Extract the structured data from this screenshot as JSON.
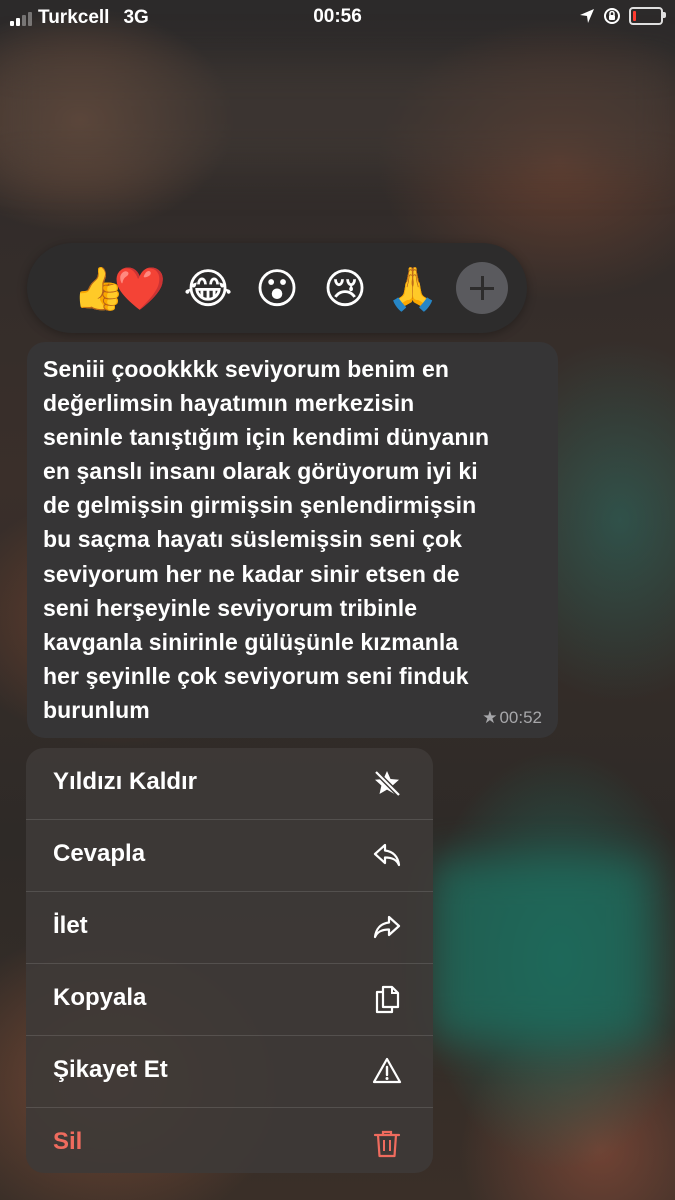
{
  "status_bar": {
    "carrier": "Turkcell",
    "network": "3G",
    "time": "00:56",
    "battery_level": 0.12
  },
  "reactions": [
    {
      "emoji": "👍",
      "icon": "thumbs-up"
    },
    {
      "emoji": "❤️",
      "icon": "red-heart"
    },
    {
      "emoji": "😂",
      "icon": "tears-of-joy"
    },
    {
      "emoji": "😮",
      "icon": "surprised-face"
    },
    {
      "emoji": "😢",
      "icon": "crying-face"
    },
    {
      "emoji": "🙏",
      "icon": "folded-hands"
    }
  ],
  "message": {
    "text": "Seniii çoookkkk seviyorum benim en\ndeğerlimsin hayatımın merkezisin\nseninle tanıştığım için kendimi dünyanın\nen şanslı insanı olarak görüyorum iyi ki\nde gelmişsin girmişsin şenlendirmişsin\nbu saçma hayatı süslemişsin seni çok\nseviyorum her ne kadar sinir etsen de\nseni herşeyinle seviyorum tribinle\nkavganla sinirinle gülüşünle kızmanla\nher şeyinlle çok seviyorum seni finduk\nburunlum",
    "star": "★",
    "time": "00:52"
  },
  "menu": {
    "items": [
      {
        "label": "Yıldızı Kaldır",
        "icon": "unstar-icon"
      },
      {
        "label": "Cevapla",
        "icon": "reply-icon"
      },
      {
        "label": "İlet",
        "icon": "forward-icon"
      },
      {
        "label": "Kopyala",
        "icon": "copy-icon"
      },
      {
        "label": "Şikayet Et",
        "icon": "warning-icon"
      },
      {
        "label": "Sil",
        "icon": "trash-icon",
        "color": "#ef6b5e"
      }
    ]
  }
}
